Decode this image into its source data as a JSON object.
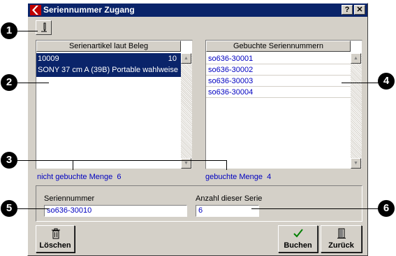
{
  "window": {
    "title": "Seriennummer Zugang",
    "help_label": "?",
    "close_label": "✕"
  },
  "left_list": {
    "header": "Serienartikel laut Beleg",
    "selected_item": {
      "number": "10009",
      "quantity": "10",
      "description": "SONY 37 cm A (39B) Portable wahlweise"
    }
  },
  "right_list": {
    "header": "Gebuchte Seriennummern",
    "items": [
      "so636-30001",
      "so636-30002",
      "so636-30003",
      "so636-30004"
    ]
  },
  "status": {
    "not_booked_label": "nicht gebuchte Menge",
    "not_booked_value": "6",
    "booked_label": "gebuchte Menge",
    "booked_value": "4"
  },
  "form": {
    "serial_label": "Seriennummer",
    "serial_value": "so636-30010",
    "count_label": "Anzahl dieser Serie",
    "count_value": "6"
  },
  "buttons": {
    "delete": "Löschen",
    "book": "Buchen",
    "back": "Zurück"
  },
  "callouts": [
    "1",
    "2",
    "3",
    "4",
    "5",
    "6"
  ],
  "colors": {
    "title_bar": "#0a246a",
    "selection": "#0a246a",
    "link_text": "#0000c0",
    "dialog_face": "#d4d0c8"
  }
}
